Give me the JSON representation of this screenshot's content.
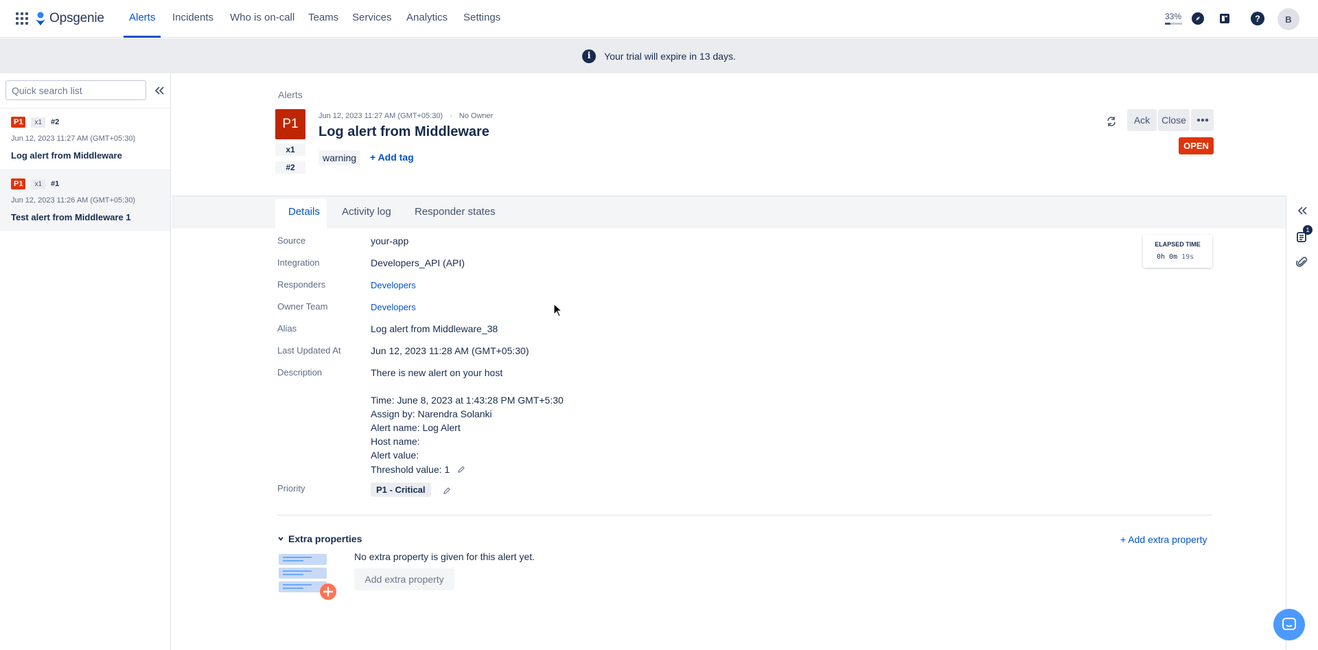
{
  "nav": {
    "logo": "Opsgenie",
    "items": [
      {
        "label": "Alerts",
        "active": true
      },
      {
        "label": "Incidents"
      },
      {
        "label": "Who is on-call"
      },
      {
        "label": "Teams"
      },
      {
        "label": "Services"
      },
      {
        "label": "Analytics"
      },
      {
        "label": "Settings"
      }
    ],
    "zoom": "33%",
    "zoom_fraction": 0.33,
    "avatar": "B",
    "icons": [
      "compass-icon",
      "book-icon",
      "help-icon"
    ]
  },
  "banner": {
    "text": "Your trial will expire in 13 days."
  },
  "sidebar": {
    "search_placeholder": "Quick search list",
    "items": [
      {
        "priority": "P1",
        "count": "x1",
        "id": "#2",
        "date": "Jun 12, 2023 11:27 AM (GMT+05:30)",
        "title": "Log alert from Middleware"
      },
      {
        "priority": "P1",
        "count": "x1",
        "id": "#1",
        "date": "Jun 12, 2023 11:26 AM (GMT+05:30)",
        "title": "Test alert from Middleware 1"
      }
    ]
  },
  "alert": {
    "breadcrumb": "Alerts",
    "priority": "P1",
    "count": "x1",
    "id": "#2",
    "date": "Jun 12, 2023 11:27 AM (GMT+05:30)",
    "separator": "·",
    "owner": "No Owner",
    "title": "Log alert from Middleware",
    "tag": "warning",
    "add_tag": "+ Add tag",
    "ack_label": "Ack",
    "close_label": "Close",
    "status": "OPEN"
  },
  "tabs": [
    {
      "label": "Details",
      "active": true
    },
    {
      "label": "Activity log"
    },
    {
      "label": "Responder states"
    }
  ],
  "right_rail": {
    "notification_count": "1"
  },
  "elapsed": {
    "title": "ELAPSED TIME",
    "value": "0h 0m",
    "seconds": "19s"
  },
  "details": {
    "source_label": "Source",
    "source": "your-app",
    "integration_label": "Integration",
    "integration": "Developers_API (API)",
    "responders_label": "Responders",
    "responders": "Developers",
    "owner_team_label": "Owner Team",
    "owner_team": "Developers",
    "alias_label": "Alias",
    "alias": "Log alert from Middleware_38",
    "last_updated_label": "Last Updated At",
    "last_updated": "Jun 12, 2023 11:28 AM (GMT+05:30)",
    "description_label": "Description",
    "description_lines": [
      "There is new alert on your host",
      "Time: June 8, 2023 at 1:43:28 PM GMT+5:30",
      "Assign by: Narendra Solanki",
      "Alert name: Log Alert",
      "Host name:",
      "Alert value:",
      "Threshold value: 1"
    ],
    "priority_label": "Priority",
    "priority": "P1 - Critical"
  },
  "extra": {
    "title": "Extra properties",
    "add_link": "+ Add extra property",
    "empty_text": "No extra property is given for this alert yet.",
    "add_button": "Add extra property"
  },
  "colors": {
    "brand": "#0052cc",
    "critical": "#de350b",
    "priority_dark": "#bf2600",
    "chat": "#4c9aff"
  }
}
